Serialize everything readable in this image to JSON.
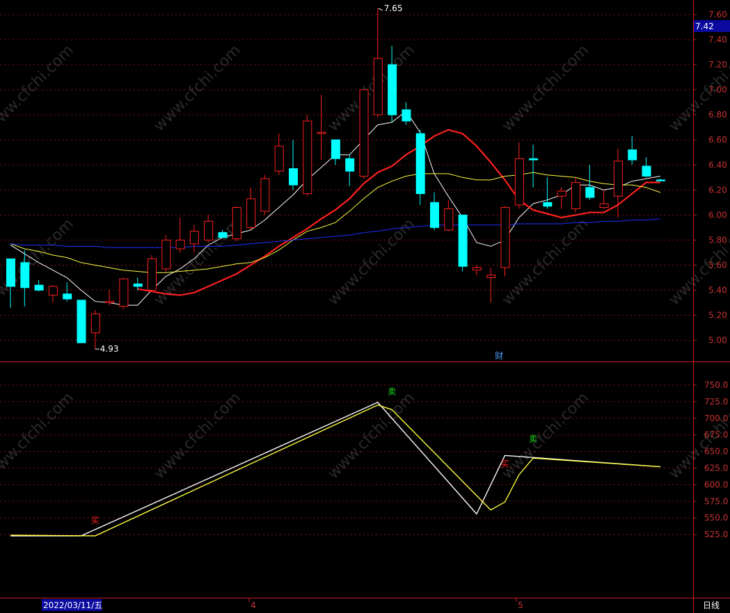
{
  "chart_data": [
    {
      "type": "candlestick",
      "panel": "price",
      "ylim": [
        4.8,
        7.65
      ],
      "yticks": [
        "7.60",
        "7.40",
        "7.20",
        "7.00",
        "6.80",
        "6.60",
        "6.40",
        "6.20",
        "6.00",
        "5.80",
        "5.60",
        "5.40",
        "5.20",
        "5.00"
      ],
      "current_price": "7.42",
      "high_marker": "7.65",
      "low_marker": "4.93",
      "event_marker": "财",
      "candles": [
        {
          "o": 5.43,
          "h": 5.6,
          "l": 5.26,
          "c": 5.65,
          "up": false
        },
        {
          "o": 5.62,
          "h": 5.72,
          "l": 5.27,
          "c": 5.42,
          "up": false
        },
        {
          "o": 5.44,
          "h": 5.48,
          "l": 5.39,
          "c": 5.4,
          "up": false
        },
        {
          "o": 5.36,
          "h": 5.44,
          "l": 5.3,
          "c": 5.43,
          "up": true
        },
        {
          "o": 5.37,
          "h": 5.46,
          "l": 5.31,
          "c": 5.33,
          "up": false
        },
        {
          "o": 5.32,
          "h": 5.32,
          "l": 4.98,
          "c": 4.98,
          "up": false
        },
        {
          "o": 5.06,
          "h": 5.24,
          "l": 4.93,
          "c": 5.21,
          "up": true
        },
        {
          "o": 5.3,
          "h": 5.4,
          "l": 5.28,
          "c": 5.31,
          "up": true
        },
        {
          "o": 5.27,
          "h": 5.5,
          "l": 5.25,
          "c": 5.49,
          "up": true
        },
        {
          "o": 5.45,
          "h": 5.5,
          "l": 5.4,
          "c": 5.43,
          "up": false
        },
        {
          "o": 5.4,
          "h": 5.68,
          "l": 5.4,
          "c": 5.65,
          "up": true
        },
        {
          "o": 5.57,
          "h": 5.84,
          "l": 5.55,
          "c": 5.8,
          "up": true
        },
        {
          "o": 5.73,
          "h": 5.98,
          "l": 5.7,
          "c": 5.8,
          "up": true
        },
        {
          "o": 5.77,
          "h": 5.92,
          "l": 5.7,
          "c": 5.87,
          "up": true
        },
        {
          "o": 5.8,
          "h": 6.0,
          "l": 5.78,
          "c": 5.95,
          "up": true
        },
        {
          "o": 5.86,
          "h": 5.88,
          "l": 5.83,
          "c": 5.82,
          "up": false
        },
        {
          "o": 5.81,
          "h": 6.07,
          "l": 5.79,
          "c": 6.06,
          "up": true
        },
        {
          "o": 5.9,
          "h": 6.22,
          "l": 5.88,
          "c": 6.13,
          "up": true
        },
        {
          "o": 6.03,
          "h": 6.32,
          "l": 6.0,
          "c": 6.29,
          "up": true
        },
        {
          "o": 6.35,
          "h": 6.65,
          "l": 6.32,
          "c": 6.55,
          "up": true
        },
        {
          "o": 6.37,
          "h": 6.6,
          "l": 6.2,
          "c": 6.24,
          "up": false
        },
        {
          "o": 6.17,
          "h": 6.8,
          "l": 6.15,
          "c": 6.75,
          "up": true
        },
        {
          "o": 6.65,
          "h": 6.96,
          "l": 6.44,
          "c": 6.66,
          "up": true
        },
        {
          "o": 6.6,
          "h": 6.6,
          "l": 6.4,
          "c": 6.45,
          "up": false
        },
        {
          "o": 6.45,
          "h": 6.48,
          "l": 6.23,
          "c": 6.35,
          "up": false
        },
        {
          "o": 6.31,
          "h": 7.0,
          "l": 6.29,
          "c": 7.0,
          "up": true
        },
        {
          "o": 6.8,
          "h": 7.65,
          "l": 6.78,
          "c": 7.25,
          "up": true
        },
        {
          "o": 7.2,
          "h": 7.35,
          "l": 6.74,
          "c": 6.8,
          "up": false
        },
        {
          "o": 6.84,
          "h": 6.9,
          "l": 6.72,
          "c": 6.75,
          "up": false
        },
        {
          "o": 6.65,
          "h": 6.68,
          "l": 6.08,
          "c": 6.17,
          "up": false
        },
        {
          "o": 6.1,
          "h": 6.18,
          "l": 5.88,
          "c": 5.9,
          "up": false
        },
        {
          "o": 6.05,
          "h": 6.12,
          "l": 5.87,
          "c": 5.88,
          "up": true
        },
        {
          "o": 6.0,
          "h": 6.0,
          "l": 5.55,
          "c": 5.59,
          "up": false
        },
        {
          "o": 5.58,
          "h": 5.6,
          "l": 5.52,
          "c": 5.56,
          "up": true
        },
        {
          "o": 5.5,
          "h": 5.58,
          "l": 5.3,
          "c": 5.52,
          "up": true
        },
        {
          "o": 5.58,
          "h": 6.07,
          "l": 5.51,
          "c": 6.06,
          "up": true
        },
        {
          "o": 6.08,
          "h": 6.58,
          "l": 6.05,
          "c": 6.45,
          "up": true
        },
        {
          "o": 6.44,
          "h": 6.56,
          "l": 6.22,
          "c": 6.45,
          "up": false
        },
        {
          "o": 6.1,
          "h": 6.3,
          "l": 6.05,
          "c": 6.07,
          "up": false
        },
        {
          "o": 6.15,
          "h": 6.22,
          "l": 6.05,
          "c": 6.19,
          "up": true
        },
        {
          "o": 6.05,
          "h": 6.3,
          "l": 6.02,
          "c": 6.26,
          "up": true
        },
        {
          "o": 6.22,
          "h": 6.4,
          "l": 6.12,
          "c": 6.14,
          "up": false
        },
        {
          "o": 6.06,
          "h": 6.2,
          "l": 6.05,
          "c": 6.09,
          "up": true
        },
        {
          "o": 6.15,
          "h": 6.53,
          "l": 5.98,
          "c": 6.43,
          "up": true
        },
        {
          "o": 6.52,
          "h": 6.63,
          "l": 6.4,
          "c": 6.44,
          "up": false
        },
        {
          "o": 6.39,
          "h": 6.46,
          "l": 6.3,
          "c": 6.31,
          "up": false
        },
        {
          "o": 6.28,
          "h": 6.29,
          "l": 6.27,
          "c": 6.28,
          "up": false
        }
      ],
      "ma_series": [
        {
          "color": "#ffffff",
          "values": [
            5.76,
            5.69,
            5.62,
            5.56,
            5.5,
            5.4,
            5.31,
            5.3,
            5.28,
            5.28,
            5.4,
            5.51,
            5.57,
            5.65,
            5.76,
            5.82,
            5.85,
            5.88,
            5.96,
            6.06,
            6.16,
            6.28,
            6.38,
            6.48,
            6.48,
            6.6,
            6.72,
            6.74,
            6.83,
            6.66,
            6.33,
            6.15,
            5.98,
            5.78,
            5.75,
            5.8,
            5.98,
            6.09,
            6.12,
            6.16,
            6.24,
            6.24,
            6.2,
            6.22,
            6.27,
            6.29,
            6.31
          ]
        },
        {
          "color": "#ff2020",
          "values": [
            null,
            null,
            null,
            null,
            null,
            null,
            null,
            null,
            null,
            5.41,
            5.39,
            5.37,
            5.36,
            5.38,
            5.43,
            5.48,
            5.53,
            5.6,
            5.67,
            5.75,
            5.82,
            5.89,
            5.97,
            6.04,
            6.13,
            6.25,
            6.34,
            6.39,
            6.48,
            6.55,
            6.63,
            6.68,
            6.65,
            6.55,
            6.42,
            6.28,
            6.12,
            6.04,
            6.01,
            5.98,
            6.0,
            6.02,
            6.02,
            6.08,
            6.17,
            6.26,
            6.26
          ]
        },
        {
          "color": "#ffff40",
          "values": [
            5.77,
            5.73,
            5.71,
            5.68,
            5.66,
            5.62,
            5.6,
            5.58,
            5.56,
            5.55,
            5.54,
            5.54,
            5.55,
            5.56,
            5.57,
            5.59,
            5.61,
            5.62,
            5.66,
            5.72,
            5.8,
            5.87,
            5.9,
            5.94,
            6.03,
            6.13,
            6.22,
            6.27,
            6.31,
            6.33,
            6.33,
            6.33,
            6.3,
            6.28,
            6.28,
            6.31,
            6.32,
            6.34,
            6.32,
            6.31,
            6.3,
            6.27,
            6.25,
            6.24,
            6.24,
            6.22,
            6.18
          ]
        },
        {
          "color": "#2030ff",
          "values": [
            5.77,
            5.76,
            5.76,
            5.76,
            5.75,
            5.75,
            5.75,
            5.74,
            5.74,
            5.74,
            5.74,
            5.74,
            5.74,
            5.75,
            5.75,
            5.75,
            5.76,
            5.77,
            5.78,
            5.79,
            5.8,
            5.81,
            5.82,
            5.83,
            5.84,
            5.86,
            5.87,
            5.89,
            5.9,
            5.91,
            5.92,
            5.92,
            5.92,
            5.92,
            5.92,
            5.92,
            5.93,
            5.93,
            5.93,
            5.93,
            5.94,
            5.94,
            5.95,
            5.95,
            5.96,
            5.96,
            5.97
          ]
        }
      ]
    },
    {
      "type": "line",
      "panel": "indicator",
      "ylim": [
        505,
        765
      ],
      "yticks": [
        "750.0",
        "725.0",
        "700.0",
        "675.0",
        "650.0",
        "625.0",
        "600.0",
        "575.0",
        "550.0",
        "525.0"
      ],
      "series": [
        {
          "color": "#ffffff",
          "points": [
            [
              0,
              523
            ],
            [
              5,
              523
            ],
            [
              26,
              724
            ],
            [
              33,
              556
            ],
            [
              35,
              644
            ],
            [
              46,
              627
            ]
          ]
        },
        {
          "color": "#ffff40",
          "points": [
            [
              0,
              524
            ],
            [
              6,
              523
            ],
            [
              26,
              720
            ],
            [
              27,
              713
            ],
            [
              34,
              562
            ],
            [
              35,
              574
            ],
            [
              36,
              615
            ],
            [
              37,
              640
            ],
            [
              46,
              627
            ]
          ]
        }
      ],
      "signals": [
        {
          "label": "买",
          "idx": 6,
          "value": 542,
          "color": "#ff2020"
        },
        {
          "label": "卖",
          "idx": 27,
          "value": 736,
          "color": "#20e020"
        },
        {
          "label": "买",
          "idx": 35,
          "value": 627,
          "color": "#ff2020"
        },
        {
          "label": "卖",
          "idx": 37,
          "value": 665,
          "color": "#20e020"
        }
      ]
    }
  ],
  "xaxis": {
    "date_label": "2022/03/11/五",
    "month_labels": [
      "4",
      "5"
    ],
    "period": "日线"
  },
  "watermark": "www.cfchi.com",
  "colors": {
    "up": "#ff2020",
    "down": "#00ffff",
    "grid": "#8a1010",
    "frame": "#c81e1e",
    "axis_text": "#c83232"
  }
}
